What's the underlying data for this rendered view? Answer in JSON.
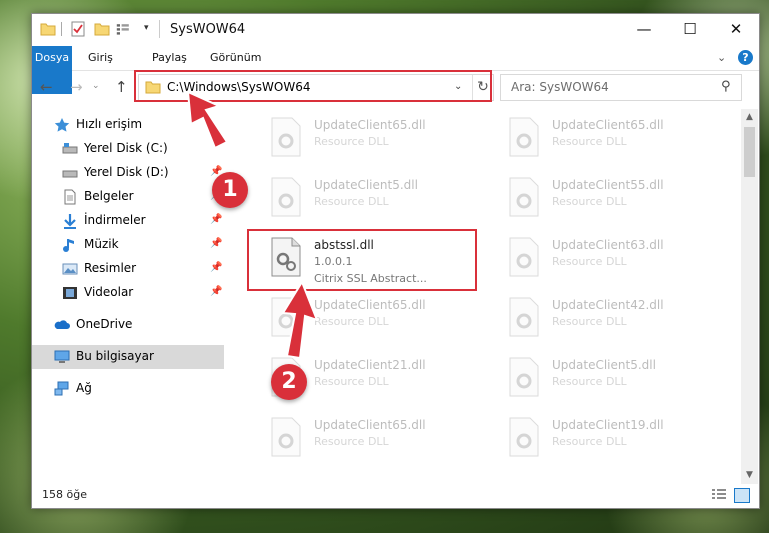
{
  "window": {
    "title": "SysWOW64"
  },
  "window_controls": {
    "minimize": "—",
    "maximize": "☐",
    "close": "✕"
  },
  "ribbon": {
    "tabs": [
      "Dosya",
      "Giriş",
      "Paylaş",
      "Görünüm"
    ],
    "help": "?"
  },
  "address": {
    "path": "C:\\Windows\\SysWOW64"
  },
  "search": {
    "placeholder": "Ara: SysWOW64"
  },
  "sidebar": {
    "items": [
      {
        "label": "Hızlı erişim",
        "icon": "star-icon",
        "pinned": false
      },
      {
        "label": "Yerel Disk (C:)",
        "icon": "drive-icon",
        "pinned": false
      },
      {
        "label": "Yerel Disk (D:)",
        "icon": "drive-icon",
        "pinned": true
      },
      {
        "label": "Belgeler",
        "icon": "documents-icon",
        "pinned": true
      },
      {
        "label": "İndirmeler",
        "icon": "download-icon",
        "pinned": true
      },
      {
        "label": "Müzik",
        "icon": "music-icon",
        "pinned": true
      },
      {
        "label": "Resimler",
        "icon": "pictures-icon",
        "pinned": true
      },
      {
        "label": "Videolar",
        "icon": "videos-icon",
        "pinned": true
      },
      {
        "label": "OneDrive",
        "icon": "onedrive-icon",
        "pinned": false
      },
      {
        "label": "Bu bilgisayar",
        "icon": "computer-icon",
        "pinned": false,
        "selected": true
      },
      {
        "label": "Ağ",
        "icon": "network-icon",
        "pinned": false
      }
    ]
  },
  "files": {
    "left": [
      {
        "name": "UpdateClient65.dll",
        "desc": "Resource DLL",
        "faded": true
      },
      {
        "name": "UpdateClient5.dll",
        "desc": "Resource DLL",
        "faded": true
      },
      {
        "name": "abstssl.dll",
        "desc": "1.0.0.1",
        "desc2": "Citrix SSL Abstract...",
        "faded": false
      },
      {
        "name": "UpdateClient65.dll",
        "desc": "Resource DLL",
        "faded": true
      },
      {
        "name": "UpdateClient21.dll",
        "desc": "Resource DLL",
        "faded": true
      },
      {
        "name": "UpdateClient65.dll",
        "desc": "Resource DLL",
        "faded": true
      }
    ],
    "right": [
      {
        "name": "UpdateClient65.dll",
        "desc": "Resource DLL"
      },
      {
        "name": "UpdateClient55.dll",
        "desc": "Resource DLL"
      },
      {
        "name": "UpdateClient63.dll",
        "desc": "Resource DLL"
      },
      {
        "name": "UpdateClient42.dll",
        "desc": "Resource DLL"
      },
      {
        "name": "UpdateClient5.dll",
        "desc": "Resource DLL"
      },
      {
        "name": "UpdateClient19.dll",
        "desc": "Resource DLL"
      }
    ]
  },
  "status": {
    "count": "158 öğe"
  },
  "annotations": {
    "badge1": "1",
    "badge2": "2",
    "color": "#d9303a"
  },
  "colors": {
    "accent": "#1979ca",
    "highlight": "#d9303a"
  }
}
